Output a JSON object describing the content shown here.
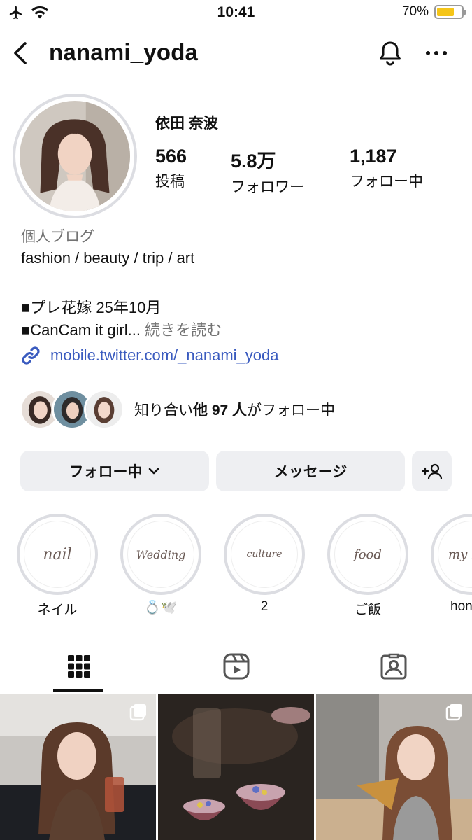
{
  "status_bar": {
    "time": "10:41",
    "battery_percent": "70%",
    "battery_level": 0.7
  },
  "header": {
    "username": "nanami_yoda"
  },
  "profile": {
    "full_name": "依田 奈波",
    "stats": [
      {
        "value": "566",
        "label": "投稿"
      },
      {
        "value": "5.8万",
        "label": "フォロワー"
      },
      {
        "value": "1,187",
        "label": "フォロー中"
      }
    ],
    "category": "個人ブログ",
    "bio_lines": [
      "fashion / beauty / trip / art",
      "",
      "■プレ花嫁 25年10月",
      "■CanCam it girl..."
    ],
    "read_more": "続きを読む",
    "link": "mobile.twitter.com/_nanami_yoda",
    "mutual": {
      "prefix": "知り合い",
      "bold": "他 97 人",
      "suffix": "がフォロー中"
    }
  },
  "buttons": {
    "following": "フォロー中",
    "message": "メッセージ",
    "add_person": "+8"
  },
  "highlights": [
    {
      "cover": "nail",
      "caption": "ネイル"
    },
    {
      "cover": "Wedding",
      "caption": "💍🕊️"
    },
    {
      "cover": "culture",
      "caption": "2"
    },
    {
      "cover": "food",
      "caption": "ご飯"
    },
    {
      "cover": "my h",
      "caption": "hon"
    }
  ],
  "tabs": [
    "grid-icon",
    "reels-icon",
    "tagged-icon"
  ],
  "colors": {
    "link": "#3a5bbf",
    "button_bg": "#eeeff2",
    "muted": "#737373",
    "battery": "#f5c518"
  }
}
